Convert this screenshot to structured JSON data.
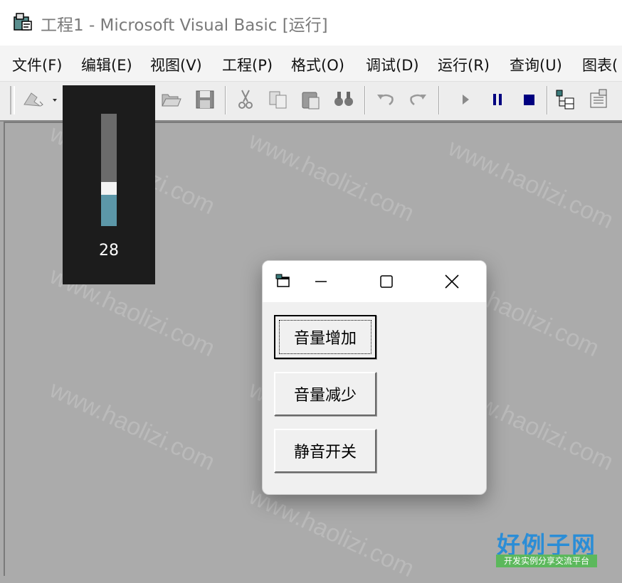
{
  "window": {
    "title": "工程1 - Microsoft Visual Basic [运行]"
  },
  "menu": {
    "items": [
      {
        "label": "文件(F)"
      },
      {
        "label": "编辑(E)"
      },
      {
        "label": "视图(V)"
      },
      {
        "label": "工程(P)"
      },
      {
        "label": "格式(O)"
      },
      {
        "label": "调试(D)"
      },
      {
        "label": "运行(R)"
      },
      {
        "label": "查询(U)"
      },
      {
        "label": "图表("
      }
    ]
  },
  "toolbar": {
    "icons": [
      "add-project-icon",
      "add-form-icon",
      "menu-editor-icon",
      "open-icon",
      "save-icon",
      "cut-icon",
      "copy-icon",
      "paste-icon",
      "find-icon",
      "undo-icon",
      "redo-icon",
      "start-icon",
      "break-icon",
      "end-icon",
      "project-explorer-icon",
      "properties-icon"
    ]
  },
  "volume": {
    "value": "28",
    "level_percent": 28
  },
  "form": {
    "buttons": [
      {
        "label": "音量增加"
      },
      {
        "label": "音量减少"
      },
      {
        "label": "静音开关"
      }
    ]
  },
  "watermark": {
    "text": "www.haolizi.com"
  },
  "logo": {
    "main": "好例子网",
    "sub": "开发实例分享交流平台"
  }
}
